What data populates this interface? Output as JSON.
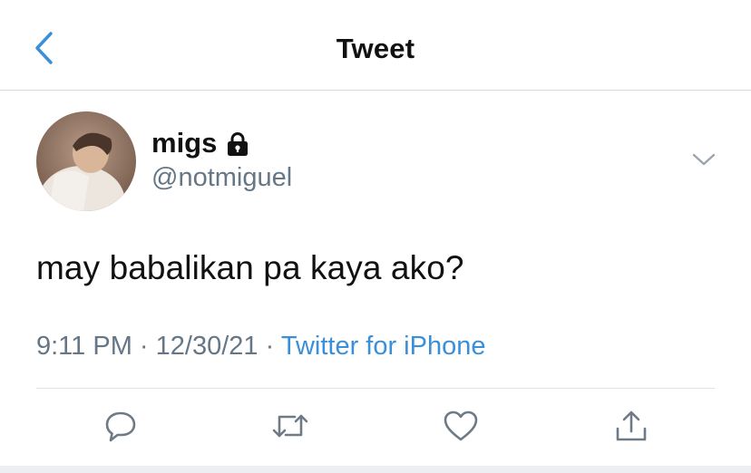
{
  "header": {
    "title": "Tweet"
  },
  "tweet": {
    "display_name": "migs",
    "handle": "@notmiguel",
    "text": "may babalikan pa kaya ako?",
    "time": "9:11 PM",
    "separator": "·",
    "date": "12/30/21",
    "source": "Twitter for iPhone"
  },
  "icons": {
    "back": "chevron-left-icon",
    "lock": "lock-icon",
    "more": "chevron-down-icon",
    "reply": "reply-icon",
    "retweet": "retweet-icon",
    "like": "heart-icon",
    "share": "share-icon"
  },
  "colors": {
    "accent": "#3b8ed8",
    "secondary_text": "#657786",
    "icon_gray": "#6e7a86"
  }
}
